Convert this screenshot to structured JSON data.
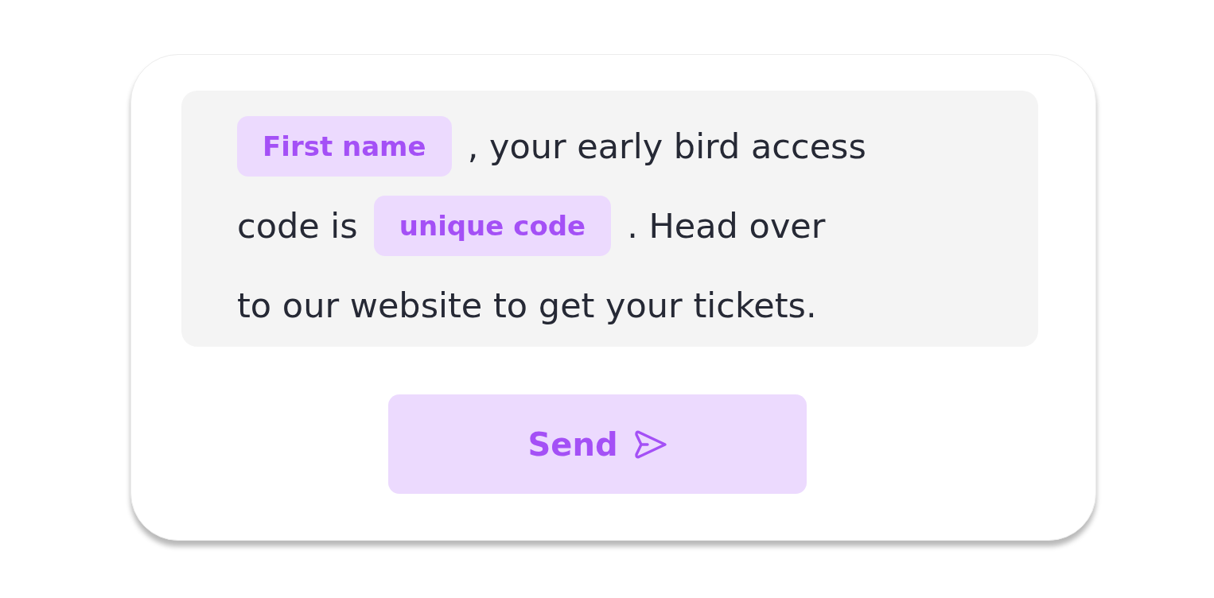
{
  "message": {
    "lines": [
      [
        {
          "kind": "tag",
          "text": "First name"
        },
        {
          "kind": "text",
          "text": ", your early bird access"
        }
      ],
      [
        {
          "kind": "text",
          "text": "code is"
        },
        {
          "kind": "tag",
          "text": "unique code"
        },
        {
          "kind": "text",
          "text": ". Head over"
        }
      ],
      [
        {
          "kind": "text",
          "text": "to our website to get your tickets."
        }
      ]
    ]
  },
  "send_button": {
    "label": "Send"
  }
}
